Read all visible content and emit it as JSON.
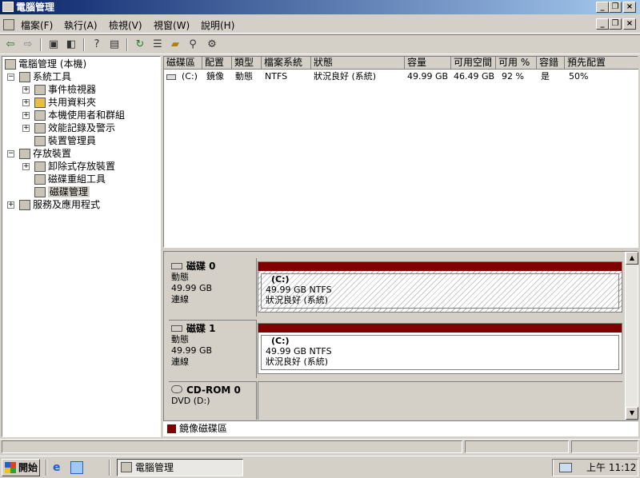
{
  "window": {
    "title": "電腦管理"
  },
  "menu": {
    "file": "檔案(F)",
    "action": "執行(A)",
    "view": "檢視(V)",
    "window": "視窗(W)",
    "help": "說明(H)"
  },
  "tree": {
    "root": "電腦管理 (本機)",
    "system_tools": "系統工具",
    "event_viewer": "事件檢視器",
    "shared_folders": "共用資料夾",
    "local_users": "本機使用者和群組",
    "perf_logs": "效能記錄及警示",
    "device_manager": "裝置管理員",
    "storage": "存放裝置",
    "removable": "卸除式存放裝置",
    "defrag": "磁碟重組工具",
    "disk_mgmt": "磁碟管理",
    "services": "服務及應用程式"
  },
  "columns": [
    "磁碟區",
    "配置",
    "類型",
    "檔案系統",
    "狀態",
    "容量",
    "可用空間",
    "可用 %",
    "容錯",
    "預先配置"
  ],
  "rows": [
    {
      "volume": "(C:)",
      "layout": "鏡像",
      "type": "動態",
      "fs": "NTFS",
      "status": "狀況良好 (系統)",
      "capacity": "49.99 GB",
      "free": "46.49 GB",
      "free_pct": "92 %",
      "fault": "是",
      "overhead": "50%"
    }
  ],
  "disks": [
    {
      "name": "磁碟 0",
      "type": "動態",
      "size": "49.99 GB",
      "state": "連線",
      "vol_label": "(C:)",
      "vol_size": "49.99 GB NTFS",
      "vol_status": "狀況良好 (系統)"
    },
    {
      "name": "磁碟 1",
      "type": "動態",
      "size": "49.99 GB",
      "state": "連線",
      "vol_label": "(C:)",
      "vol_size": "49.99 GB NTFS",
      "vol_status": "狀況良好 (系統)"
    },
    {
      "name": "CD-ROM 0",
      "type": "DVD (D:)"
    }
  ],
  "legend": {
    "mirror": "鏡像磁碟區",
    "color": "#800000"
  },
  "taskbar": {
    "start": "開始",
    "task": "電腦管理",
    "clock": "上午 11:12"
  }
}
